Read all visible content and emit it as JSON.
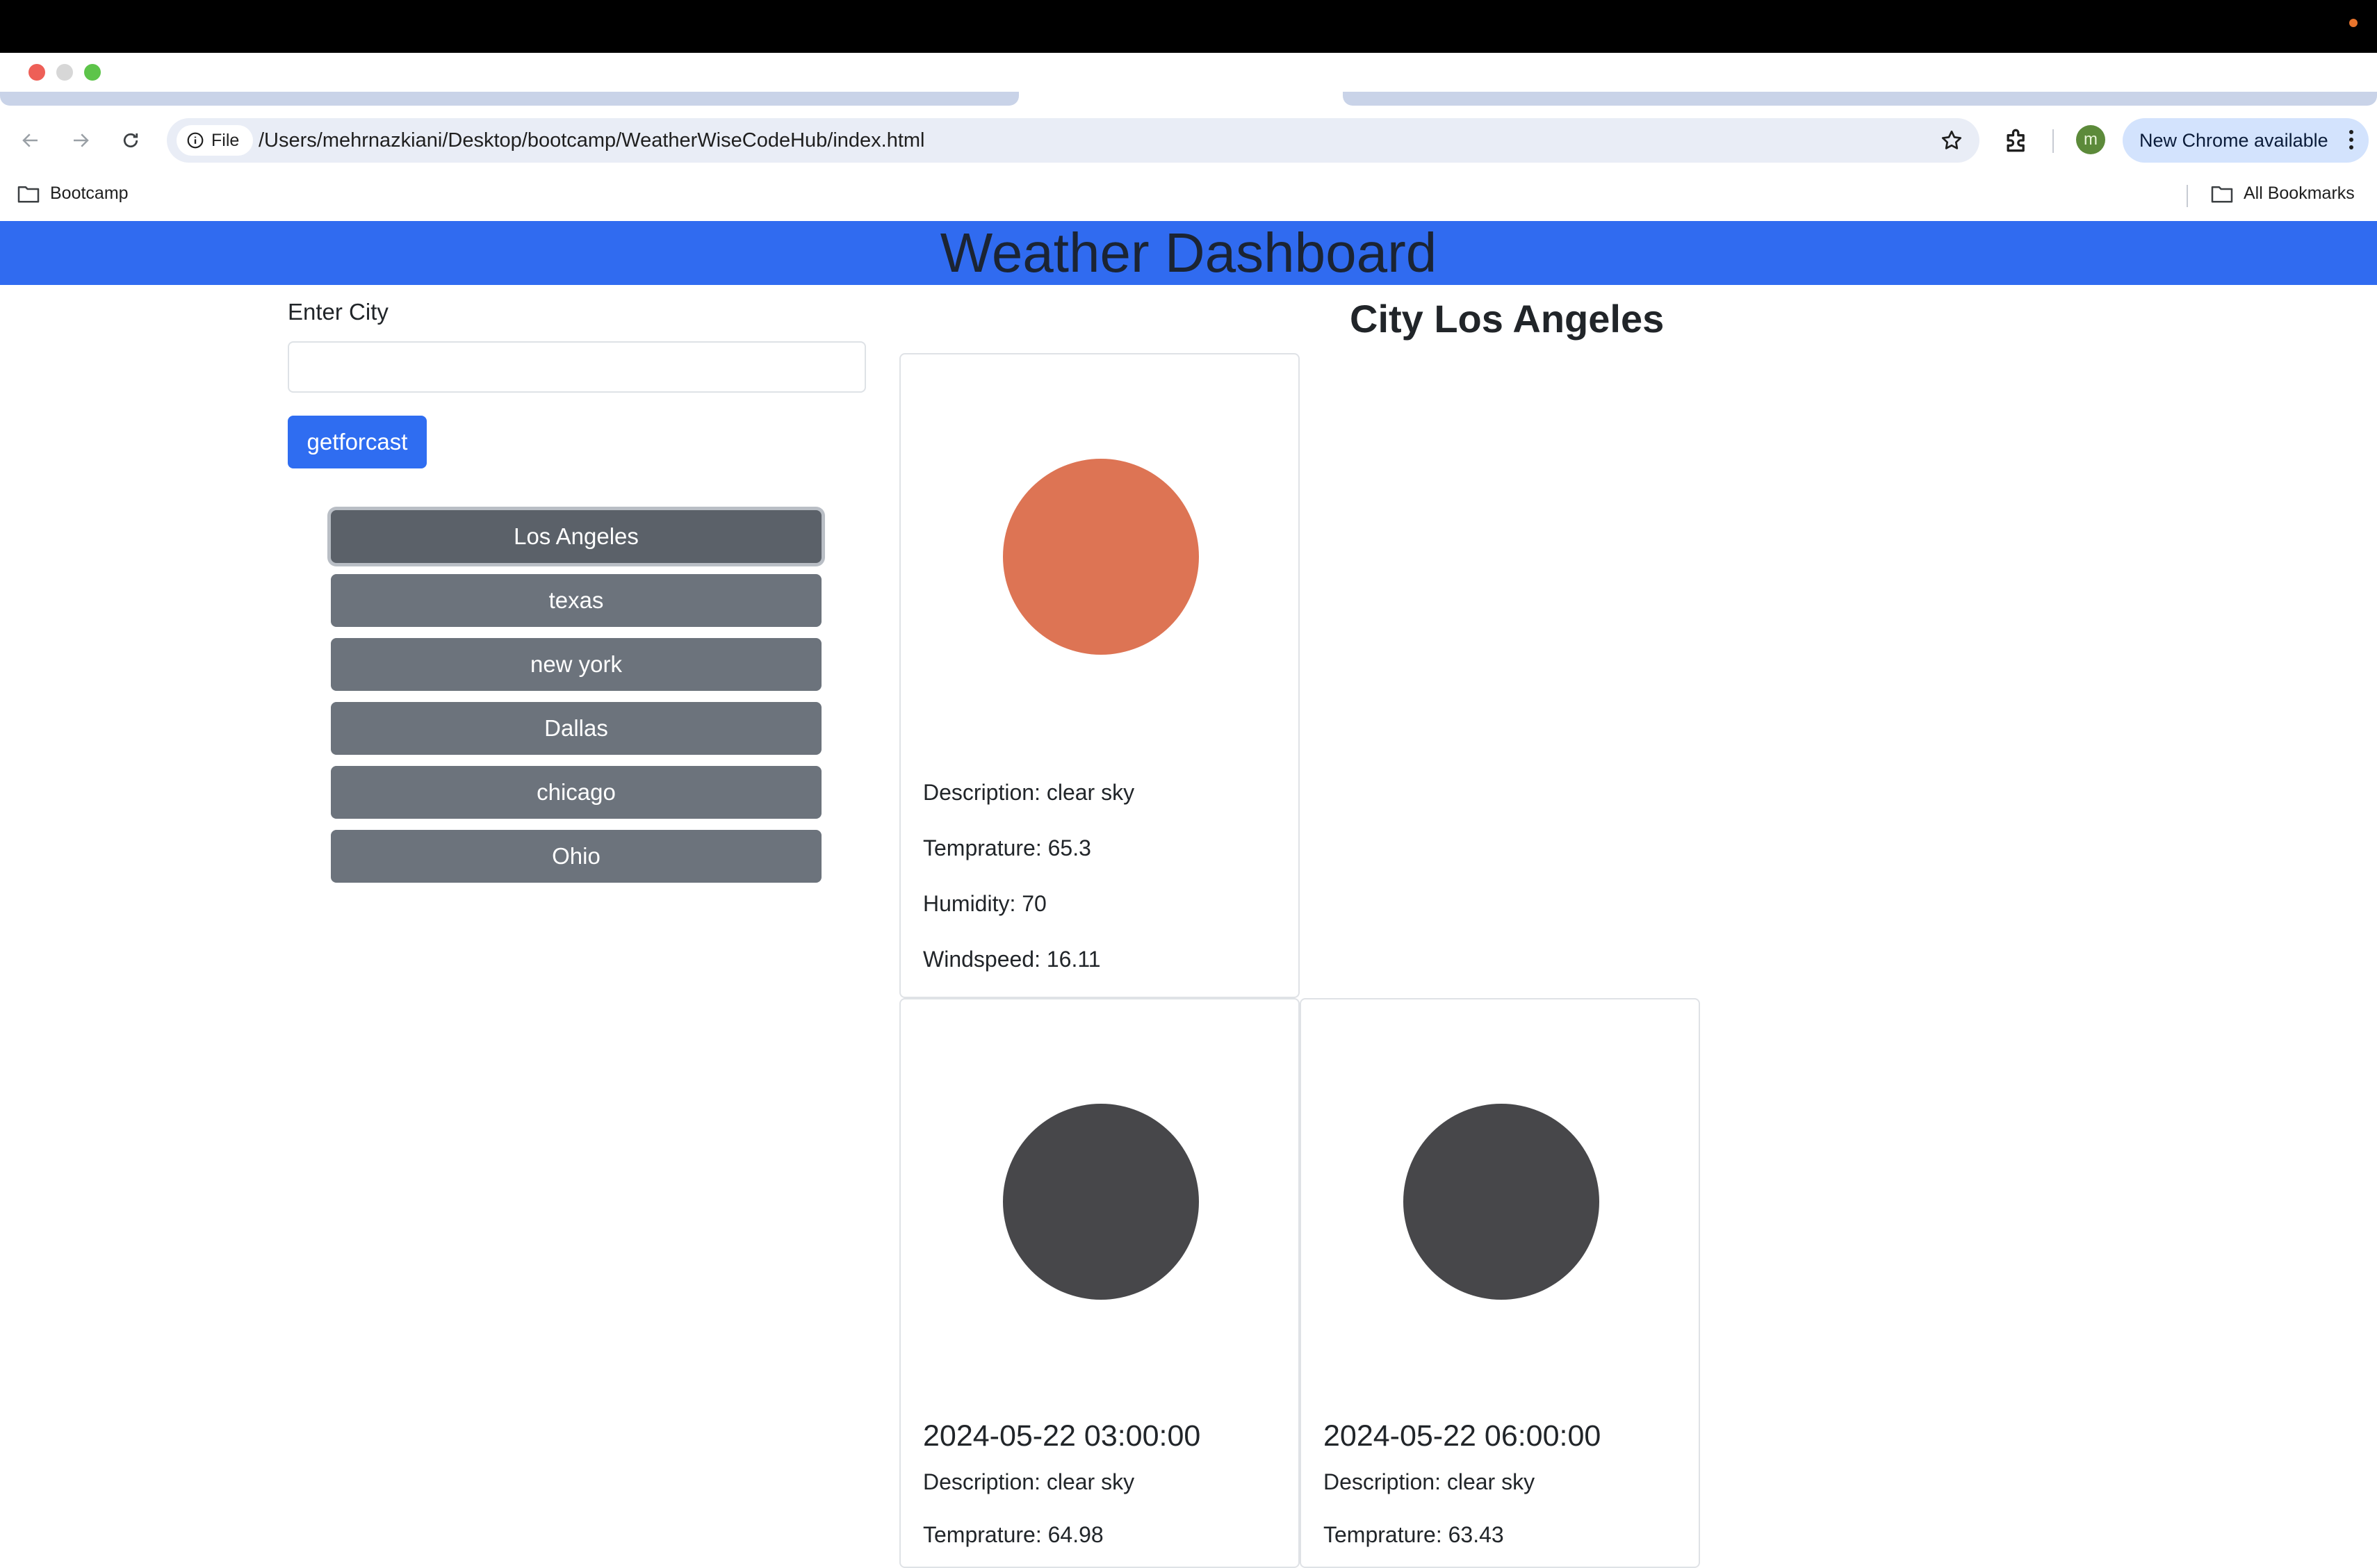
{
  "browser": {
    "file_chip": "File",
    "url": "/Users/mehrnazkiani/Desktop/bootcamp/WeatherWiseCodeHub/index.html",
    "profile_initial": "m",
    "update_label": "New Chrome available",
    "bookmarks": [
      {
        "label": "Bootcamp"
      },
      {
        "label": "All Bookmarks"
      }
    ]
  },
  "page": {
    "header_title": "Weather Dashboard",
    "city_label": "Enter City",
    "city_input_value": "",
    "forecast_button": "getforcast",
    "city_buttons": [
      "Los Angeles",
      "texas",
      "new york",
      "Dallas",
      "chicago",
      "Ohio"
    ],
    "city_heading": "City Los Angeles",
    "current": {
      "icon_color": "#dd7454",
      "description": "Description: clear sky",
      "temperature": "Temprature: 65.3",
      "humidity": "Humidity: 70",
      "windspeed": "Windspeed: 16.11"
    },
    "forecast": [
      {
        "date": "2024-05-22 03:00:00",
        "icon_color": "#47474a",
        "description": "Description: clear sky",
        "temperature": "Temprature: 64.98"
      },
      {
        "date": "2024-05-22 06:00:00",
        "icon_color": "#47474a",
        "description": "Description: clear sky",
        "temperature": "Temprature: 63.43"
      }
    ]
  },
  "colors": {
    "header_bg": "#306bf0",
    "primary_button": "#2f6df1",
    "secondary_button": "#6c737c"
  }
}
